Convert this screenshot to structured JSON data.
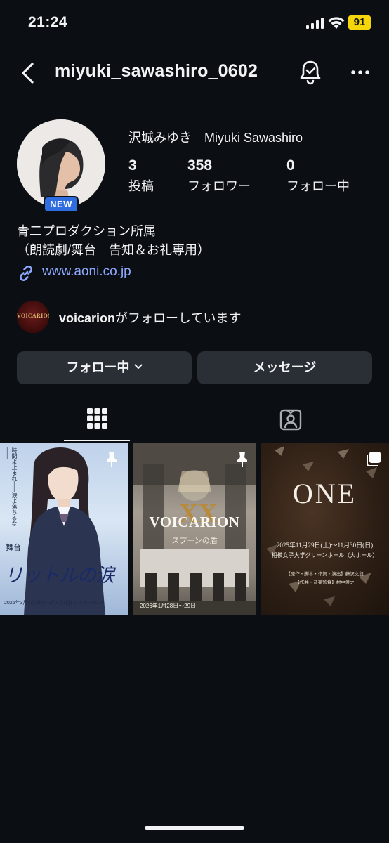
{
  "status": {
    "time": "21:24",
    "battery": "91"
  },
  "header": {
    "username": "miyuki_sawashiro_0602"
  },
  "profile": {
    "new_badge": "NEW",
    "display_name": "沢城みゆき　Miyuki Sawashiro",
    "stats": [
      {
        "value": "3",
        "label": "投稿"
      },
      {
        "value": "358",
        "label": "フォロワー"
      },
      {
        "value": "0",
        "label": "フォロー中"
      }
    ],
    "bio": [
      "青二プロダクション所属",
      "（朗読劇/舞台　告知＆お礼専用）"
    ],
    "link": "www.aoni.co.jp",
    "followed_by": {
      "account": "voicarion",
      "suffix": "がフォローしています",
      "avatar_text": "VOICARION"
    }
  },
  "actions": {
    "follow_label": "フォロー中",
    "message_label": "メッセージ"
  },
  "tabs": [
    {
      "name": "posts-grid"
    },
    {
      "name": "tagged"
    }
  ],
  "posts": [
    {
      "tagline": "時間よ止まれ――涙よ落ちるな――",
      "category": "舞台",
      "title": "リットルの涙",
      "dates": "2026年3月4日(水)～3月8日(日) シアター1010",
      "pinned": true
    },
    {
      "title": "VOICARION",
      "roman": "XX",
      "subtitle": "スプーンの盾",
      "dates": "2026年1月28日～29日",
      "pinned": true
    },
    {
      "title": "ONE",
      "dates": "2025年11月29日(土)～11月30日(日)",
      "venue": "相模女子大学グリーンホール（大ホール）",
      "credit1": "【原作・脚本・作詞・演出】藤沢文翁",
      "credit2": "【作曲・音楽監督】村中俊之",
      "multi": true
    }
  ],
  "colors": {
    "background": "#0b0f13",
    "button": "#2a2e35",
    "link": "#8ea8ff",
    "badge": "#2f6ce0",
    "battery": "#f5d60b"
  }
}
